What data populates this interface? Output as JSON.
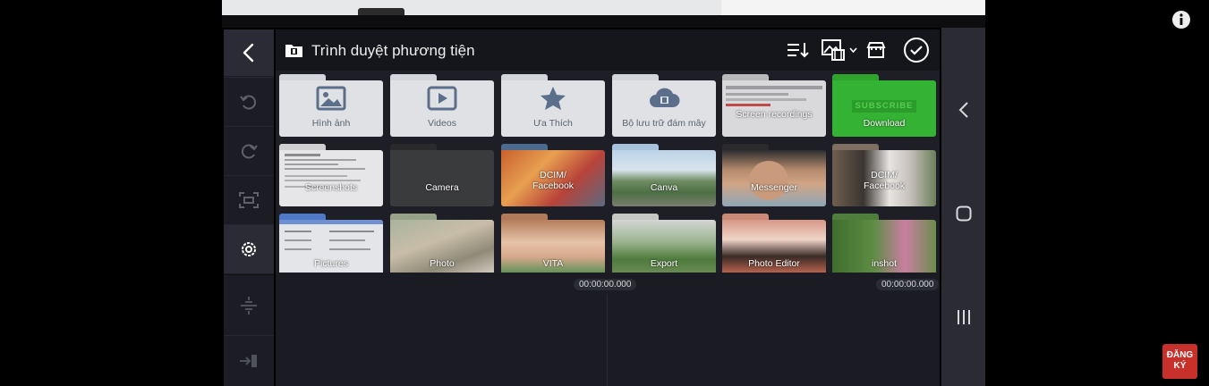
{
  "header": {
    "title": "Trình duyệt phương tiện"
  },
  "folders": [
    {
      "label": "Hình ảnh",
      "icon": "image-icon"
    },
    {
      "label": "Videos",
      "icon": "play-icon"
    },
    {
      "label": "Ưa Thích",
      "icon": "star-icon"
    },
    {
      "label": "Bộ lưu trữ đám mây",
      "icon": "cloud-icon"
    },
    {
      "label": "Screen recordings"
    },
    {
      "label": "Download",
      "overlay_text": "SUBSCRIBE"
    },
    {
      "label": "Screenshots"
    },
    {
      "label": "Camera"
    },
    {
      "label": "DCIM/\nFacebook"
    },
    {
      "label": "Canva"
    },
    {
      "label": "Messenger"
    },
    {
      "label": "DCIM/\nFacebook"
    },
    {
      "label": "Pictures"
    },
    {
      "label": "Photo"
    },
    {
      "label": "VITA"
    },
    {
      "label": "Export"
    },
    {
      "label": "Photo Editor"
    },
    {
      "label": "inshot"
    }
  ],
  "timeline": {
    "time_left": "00:00:00.000",
    "time_right": "00:00:00.000"
  },
  "overlay": {
    "subscribe_badge": "ĐĂNG\nKÝ",
    "info_icon": "info-icon"
  },
  "colors": {
    "accent_green": "#34b233",
    "panel_bg": "#1b1c23",
    "folder_light": "#dfe1e5",
    "subscribe_red": "#c8312b"
  }
}
